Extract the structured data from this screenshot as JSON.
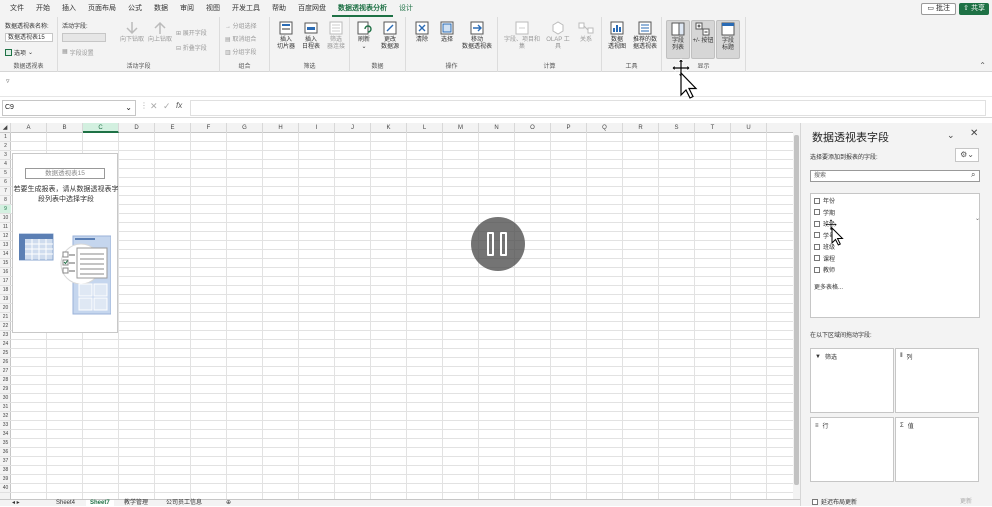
{
  "menubar": {
    "items": [
      "文件",
      "开始",
      "插入",
      "页面布局",
      "公式",
      "数据",
      "审阅",
      "视图",
      "开发工具",
      "帮助",
      "百度网盘",
      "数据透视表分析",
      "设计"
    ],
    "active_index": 11,
    "comment_label": "批注",
    "share_label": "共享"
  },
  "ribbon": {
    "pivot_group": {
      "name_label": "数据透视表名称:",
      "name_value": "数据透视表15",
      "options_label": "选项",
      "group_label": "数据透视表"
    },
    "active_field_group": {
      "label": "活动字段:",
      "settings_label": "字段设置",
      "drill_down": "向下钻取",
      "drill_up": "向上钻取",
      "expand": "展开字段",
      "collapse": "折叠字段",
      "group_label": "活动字段"
    },
    "grouping_group": {
      "items": [
        "分组选择",
        "取消组合",
        "分组字段"
      ],
      "group_label": "组合"
    },
    "filter_group": {
      "buttons": [
        "插入\n切片器",
        "插入\n日程表",
        "筛选\n器连接"
      ],
      "group_label": "筛选"
    },
    "data_group": {
      "buttons": [
        "刷新",
        "更改\n数据源"
      ],
      "group_label": "数据"
    },
    "actions_group": {
      "buttons": [
        "清除",
        "选择",
        "移动\n数据透视表"
      ],
      "group_label": "操作"
    },
    "calc_group": {
      "buttons": [
        "字段、项目和\n集",
        "OLAP 工\n具",
        "关系"
      ],
      "group_label": "计算"
    },
    "tools_group": {
      "buttons": [
        "数据\n透视图",
        "推荐的数\n据透视表"
      ],
      "group_label": "工具"
    },
    "show_group": {
      "buttons": [
        "字段\n列表",
        "+/- 按钮",
        "字段\n标题"
      ],
      "group_label": "显示"
    }
  },
  "formula_bar": {
    "name_box": "C9",
    "fx_label": "fx",
    "value": ""
  },
  "grid": {
    "columns": [
      "A",
      "B",
      "C",
      "D",
      "E",
      "F",
      "G",
      "H",
      "I",
      "J",
      "K",
      "L",
      "M",
      "N",
      "O",
      "P",
      "Q",
      "R",
      "S",
      "T",
      "U"
    ],
    "selected_column": "C",
    "rows": [
      "1",
      "2",
      "3",
      "4",
      "5",
      "6",
      "7",
      "8",
      "9",
      "10",
      "11",
      "12",
      "13",
      "14",
      "15",
      "16",
      "17",
      "18",
      "19",
      "20",
      "21",
      "22",
      "23",
      "24",
      "25",
      "26",
      "27",
      "28",
      "29",
      "30",
      "31",
      "32",
      "33",
      "34",
      "35",
      "36",
      "37",
      "38",
      "39",
      "40"
    ],
    "selected_row": "9"
  },
  "pivot_placeholder": {
    "name": "数据透视表15",
    "hint": "若要生成报表，请从数据透视表字段列表中选择字段"
  },
  "sheet_tabs": {
    "tabs": [
      "Sheet4",
      "Sheet7",
      "教学管理",
      "公司员工信息"
    ],
    "active_index": 1
  },
  "field_pane": {
    "title": "数据透视表字段",
    "subtitle": "选择要添加到报表的字段:",
    "search_placeholder": "搜索",
    "fields": [
      "年份",
      "学期",
      "班级",
      "学号",
      "班级",
      "课程",
      "教师"
    ],
    "more_tables": "更多表格...",
    "drag_label": "在以下区域间拖动字段:",
    "areas": {
      "filter": "筛选",
      "columns": "列",
      "rows": "行",
      "values": "值"
    },
    "defer_label": "延迟布局更新",
    "update_label": "更新"
  }
}
